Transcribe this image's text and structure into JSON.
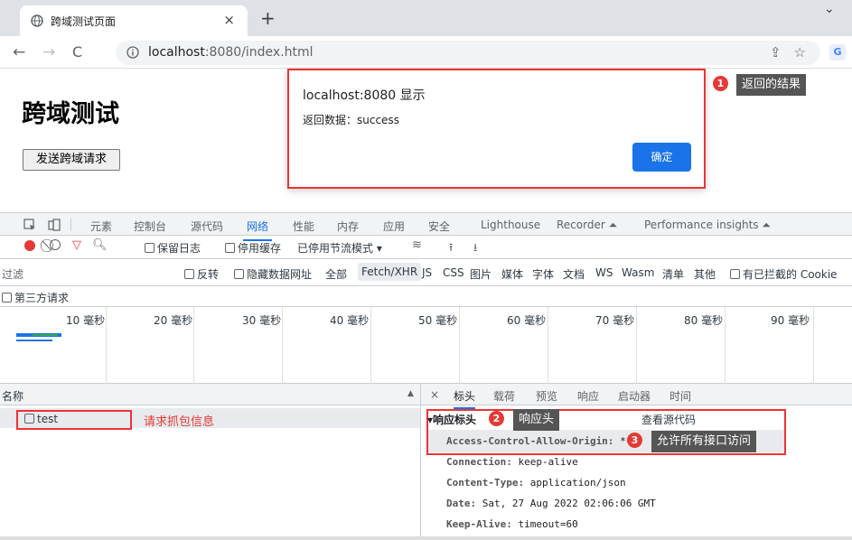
{
  "browser": {
    "tab_title": "跨域测试页面",
    "tab_close": "×",
    "new_tab": "+",
    "tab_menu": "⌄",
    "url_host": "localhost",
    "url_rest": ":8080/index.html",
    "ext_label": "G"
  },
  "page": {
    "heading": "跨域测试",
    "send_button": "发送跨域请求"
  },
  "dialog": {
    "title": "localhost:8080 显示",
    "message": "返回数据：success",
    "ok_label": "确定"
  },
  "annotations": {
    "a1": {
      "badge": "1",
      "text": "返回的结果"
    },
    "a2": {
      "badge": "2",
      "text": "响应头"
    },
    "a3": {
      "badge": "3",
      "text": "允许所有接口访问"
    },
    "request_label": "请求抓包信息"
  },
  "devtools": {
    "tabs": [
      "元素",
      "控制台",
      "源代码",
      "网络",
      "性能",
      "内存",
      "应用",
      "安全",
      "Lighthouse",
      "Recorder ⏶",
      "Performance insights ⏶"
    ],
    "toolbar": {
      "preserve_log": "保留日志",
      "disable_cache": "停用缓存",
      "throttle": "已停用节流模式"
    },
    "filter": {
      "placeholder": "过滤",
      "invert": "反转",
      "hide_data_urls": "隐藏数据网址",
      "types": [
        "全部",
        "Fetch/XHR",
        "JS",
        "CSS",
        "图片",
        "媒体",
        "字体",
        "文档",
        "WS",
        "Wasm",
        "清单",
        "其他"
      ],
      "blocked_cookies": "有已拦截的 Cookie"
    },
    "third_party": "第三方请求",
    "timeline_labels": [
      "10 毫秒",
      "20 毫秒",
      "30 毫秒",
      "40 毫秒",
      "50 毫秒",
      "60 毫秒",
      "70 毫秒",
      "80 毫秒",
      "90 毫秒"
    ],
    "names_header": "名称",
    "request_name": "test",
    "detail_tabs": [
      "×",
      "标头",
      "载荷",
      "预览",
      "响应",
      "启动器",
      "时间"
    ],
    "response_headers_title": "▾响应标头",
    "view_source": "查看源代码",
    "headers": [
      {
        "name": "Access-Control-Allow-Origin:",
        "value": "*"
      },
      {
        "name": "Connection:",
        "value": "keep-alive"
      },
      {
        "name": "Content-Type:",
        "value": "application/json"
      },
      {
        "name": "Date:",
        "value": "Sat, 27 Aug 2022 02:06:06 GMT"
      },
      {
        "name": "Keep-Alive:",
        "value": "timeout=60"
      }
    ]
  },
  "colors": {
    "accent": "#1a73e8",
    "annotation_red": "#e53935"
  }
}
